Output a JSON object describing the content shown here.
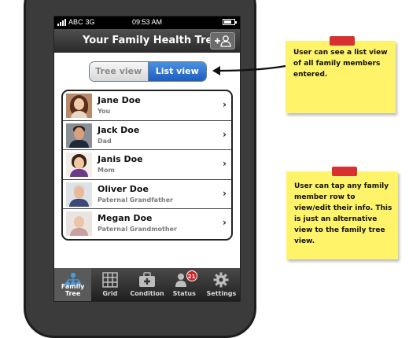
{
  "status_bar": {
    "carrier": "ABC",
    "network": "3G",
    "time": "09:53 AM"
  },
  "app": {
    "title": "Your Family Health Tree"
  },
  "view_toggle": {
    "tree_label": "Tree view",
    "list_label": "List view",
    "selected": "List view"
  },
  "members": [
    {
      "name": "Jane Doe",
      "relation": "You"
    },
    {
      "name": "Jack Doe",
      "relation": "Dad"
    },
    {
      "name": "Janis Doe",
      "relation": "Mom"
    },
    {
      "name": "Oliver Doe",
      "relation": "Paternal Grandfather"
    },
    {
      "name": "Megan Doe",
      "relation": "Paternal Grandmother"
    }
  ],
  "tabs": [
    {
      "label": "Family Tree",
      "icon": "family-tree-icon",
      "active": true
    },
    {
      "label": "Grid",
      "icon": "grid-icon"
    },
    {
      "label": "Condition",
      "icon": "medical-kit-icon"
    },
    {
      "label": "Status",
      "icon": "people-status-icon",
      "badge": "21"
    },
    {
      "label": "Settings",
      "icon": "gear-icon"
    }
  ],
  "notes": [
    {
      "text": "User can see a list view of all family members entered."
    },
    {
      "text": "User can tap any family member row to view/edit their info. This is just an alternative view to the family tree view."
    }
  ],
  "colors": {
    "accent": "#1d5fc0",
    "note": "#fff36a",
    "badge": "#d32020",
    "tape": "#d83030"
  }
}
